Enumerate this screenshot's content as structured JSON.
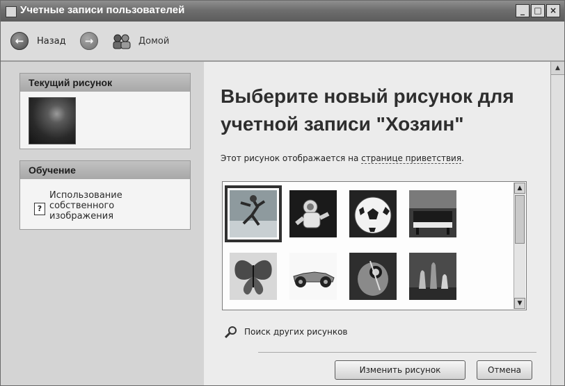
{
  "window": {
    "title": "Учетные записи пользователей",
    "controls": {
      "minimize": "_",
      "maximize": "□",
      "close": "×"
    }
  },
  "toolbar": {
    "back_label": "Назад",
    "back_icon": "arrow-left-icon",
    "forward_icon": "arrow-right-icon",
    "home_label": "Домой",
    "home_icon": "users-home-icon"
  },
  "sidebar": {
    "current_picture": {
      "heading": "Текущий рисунок"
    },
    "learn": {
      "heading": "Обучение",
      "items": [
        {
          "label": "Использование собственного изображения",
          "icon": "help-icon"
        }
      ]
    }
  },
  "main": {
    "heading": "Выберите новый рисунок для учетной записи \"Хозяин\"",
    "description_prefix": "Этот рисунок отображается на ",
    "description_link": "странице приветствия",
    "description_suffix": ".",
    "pictures": [
      {
        "name": "skater",
        "selected": true
      },
      {
        "name": "astronaut",
        "selected": false
      },
      {
        "name": "soccer-ball",
        "selected": false
      },
      {
        "name": "piano",
        "selected": false
      },
      {
        "name": "butterfly",
        "selected": false
      },
      {
        "name": "race-car",
        "selected": false
      },
      {
        "name": "guitar",
        "selected": false
      },
      {
        "name": "chess",
        "selected": false
      }
    ],
    "browse_label": "Поиск других рисунков",
    "browse_icon": "magnifier-icon",
    "buttons": {
      "change": "Изменить рисунок",
      "cancel": "Отмена"
    }
  },
  "colors": {
    "titlebar": "#6e6e6e",
    "panel_header": "#aeaeae",
    "background": "#ececec"
  }
}
